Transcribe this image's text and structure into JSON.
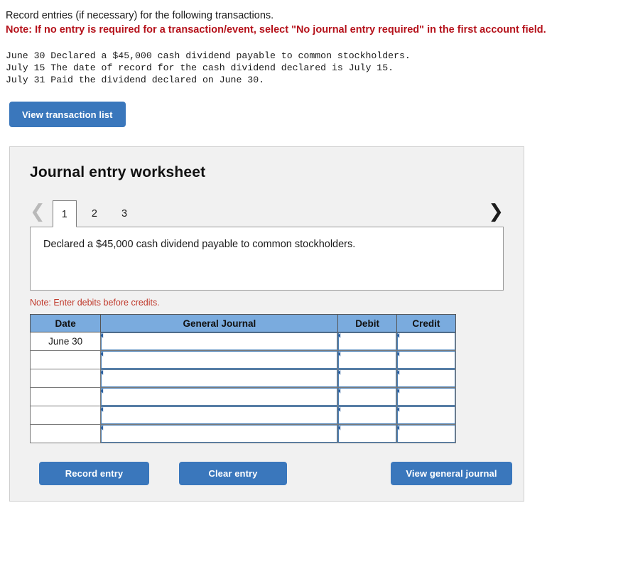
{
  "intro": {
    "instruction": "Record entries (if necessary) for the following transactions.",
    "note": "Note: If no entry is required for a transaction/event, select \"No journal entry required\" in the first account field."
  },
  "transactions": [
    "June 30 Declared a $45,000 cash dividend payable to common stockholders.",
    "July 15 The date of record for the cash dividend declared is July 15.",
    "July 31 Paid the dividend declared on June 30."
  ],
  "toolbar": {
    "view_transaction_list_label": "View transaction list"
  },
  "worksheet": {
    "title": "Journal entry worksheet",
    "prev_icon": "chevron-left-icon",
    "next_icon": "chevron-right-icon",
    "prev_enabled": false,
    "next_enabled": true,
    "tabs": [
      {
        "label": "1",
        "active": true
      },
      {
        "label": "2",
        "active": false
      },
      {
        "label": "3",
        "active": false
      }
    ],
    "description": "Declared a $45,000 cash dividend payable to common stockholders.",
    "debit_note": "Note: Enter debits before credits.",
    "table": {
      "columns": [
        "Date",
        "General Journal",
        "Debit",
        "Credit"
      ],
      "rows": [
        {
          "date": "June 30",
          "journal": "",
          "debit": "",
          "credit": ""
        },
        {
          "date": "",
          "journal": "",
          "debit": "",
          "credit": ""
        },
        {
          "date": "",
          "journal": "",
          "debit": "",
          "credit": ""
        },
        {
          "date": "",
          "journal": "",
          "debit": "",
          "credit": ""
        },
        {
          "date": "",
          "journal": "",
          "debit": "",
          "credit": ""
        },
        {
          "date": "",
          "journal": "",
          "debit": "",
          "credit": ""
        }
      ]
    },
    "actions": {
      "record_entry_label": "Record entry",
      "clear_entry_label": "Clear entry",
      "view_general_journal_label": "View general journal"
    }
  },
  "colors": {
    "button_blue": "#3a77bc",
    "table_header_blue": "#7aabde",
    "note_red_bold": "#b5121b",
    "note_red": "#c0392b",
    "panel_bg": "#f1f1f1",
    "field_border_blue": "#4a7fb5"
  }
}
